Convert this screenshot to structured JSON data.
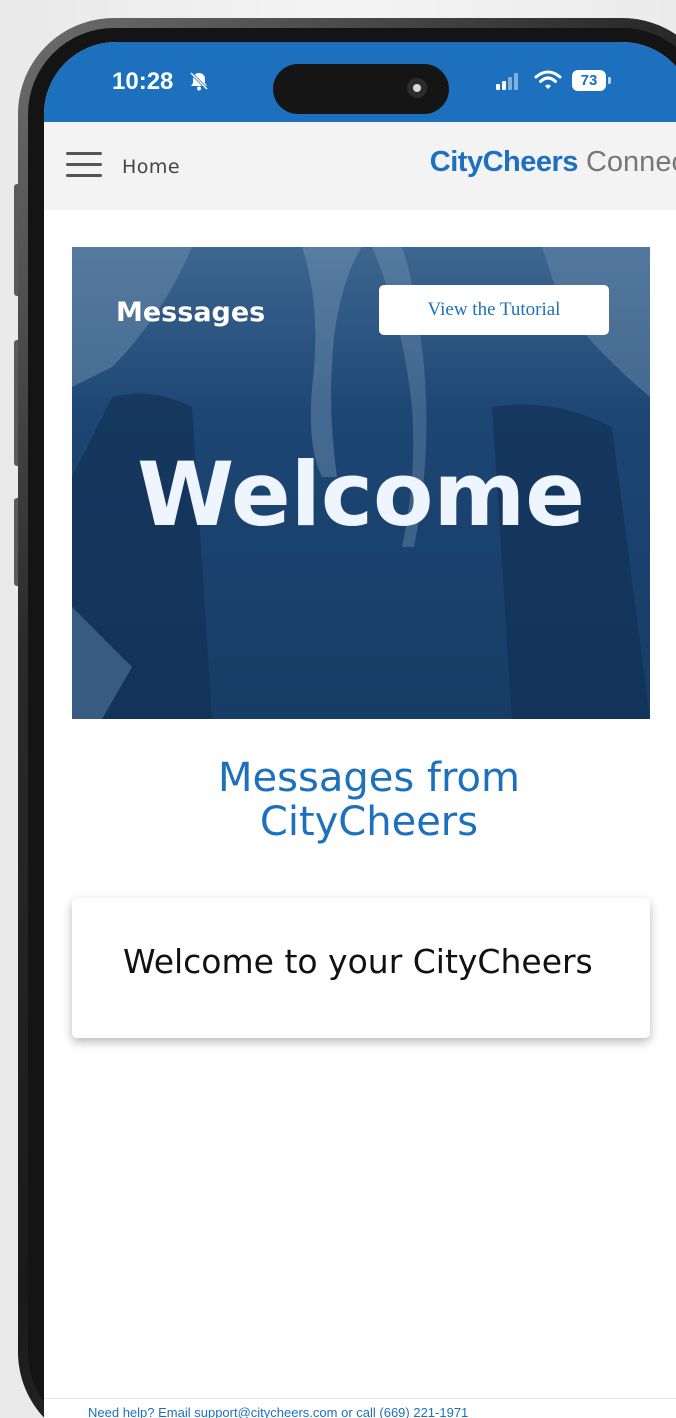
{
  "status_bar": {
    "time": "10:28",
    "battery": "73"
  },
  "header": {
    "nav_label": "Home",
    "brand_bold": "CityCheers",
    "brand_light": "Connect"
  },
  "hero": {
    "section_title": "Messages",
    "tutorial_button": "View the Tutorial",
    "welcome_text": "Welcome"
  },
  "main": {
    "heading_line1": "Messages from",
    "heading_line2": "CityCheers",
    "message_preview": "Welcome to your CityCheers"
  },
  "footer": {
    "help_prefix": "Need help? Email ",
    "email": "support@citycheers.com",
    "help_middle": " or call ",
    "phone": "(669) 221-1971"
  },
  "colors": {
    "brand_blue": "#1c70bd",
    "hero_overlay": "#1f4a78"
  }
}
